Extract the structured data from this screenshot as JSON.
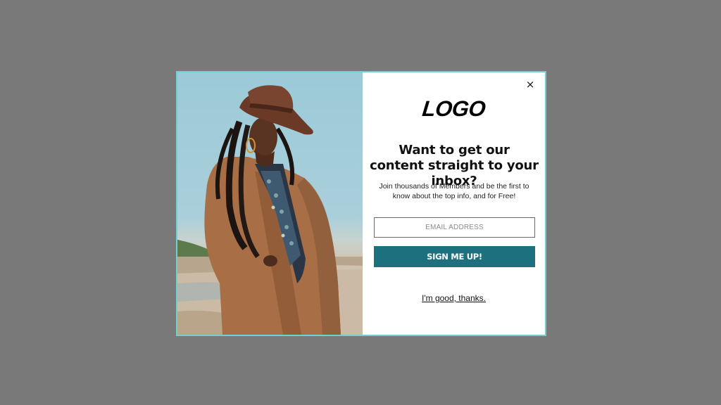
{
  "popup": {
    "logo_text": "LOGO",
    "close_icon": "×",
    "headline": "Want to get our content straight to your inbox?",
    "subtext": "Join thousands of Members and be the first to know about the top info, and for Free!",
    "email": {
      "placeholder": "EMAIL ADDRESS",
      "value": ""
    },
    "submit_label": "SIGN ME UP!",
    "decline_label": "I'm good, thanks."
  },
  "colors": {
    "overlay": "#797979",
    "modal_border": "#6fd0cf",
    "button_bg": "#1d717f",
    "button_text": "#ffffff"
  },
  "icons": {
    "close": "close-icon"
  }
}
